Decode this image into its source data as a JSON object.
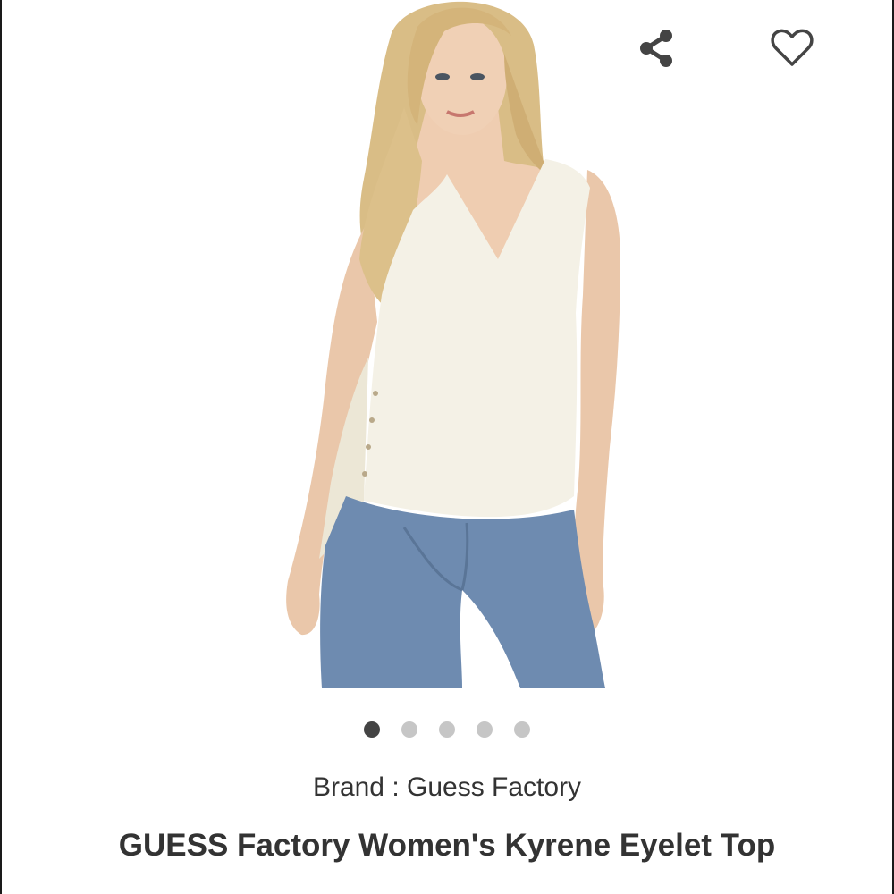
{
  "icons": {
    "share": "share-icon",
    "wishlist": "heart-outline-icon",
    "icon_color": "#444444"
  },
  "gallery": {
    "image_count": 5,
    "active_index": 0,
    "image_alt": "model-wearing-white-sleeveless-v-neck-top-and-light-blue-jeans"
  },
  "product": {
    "brand_line": "Brand : Guess Factory",
    "title": "GUESS Factory Women's Kyrene Eyelet Top"
  }
}
